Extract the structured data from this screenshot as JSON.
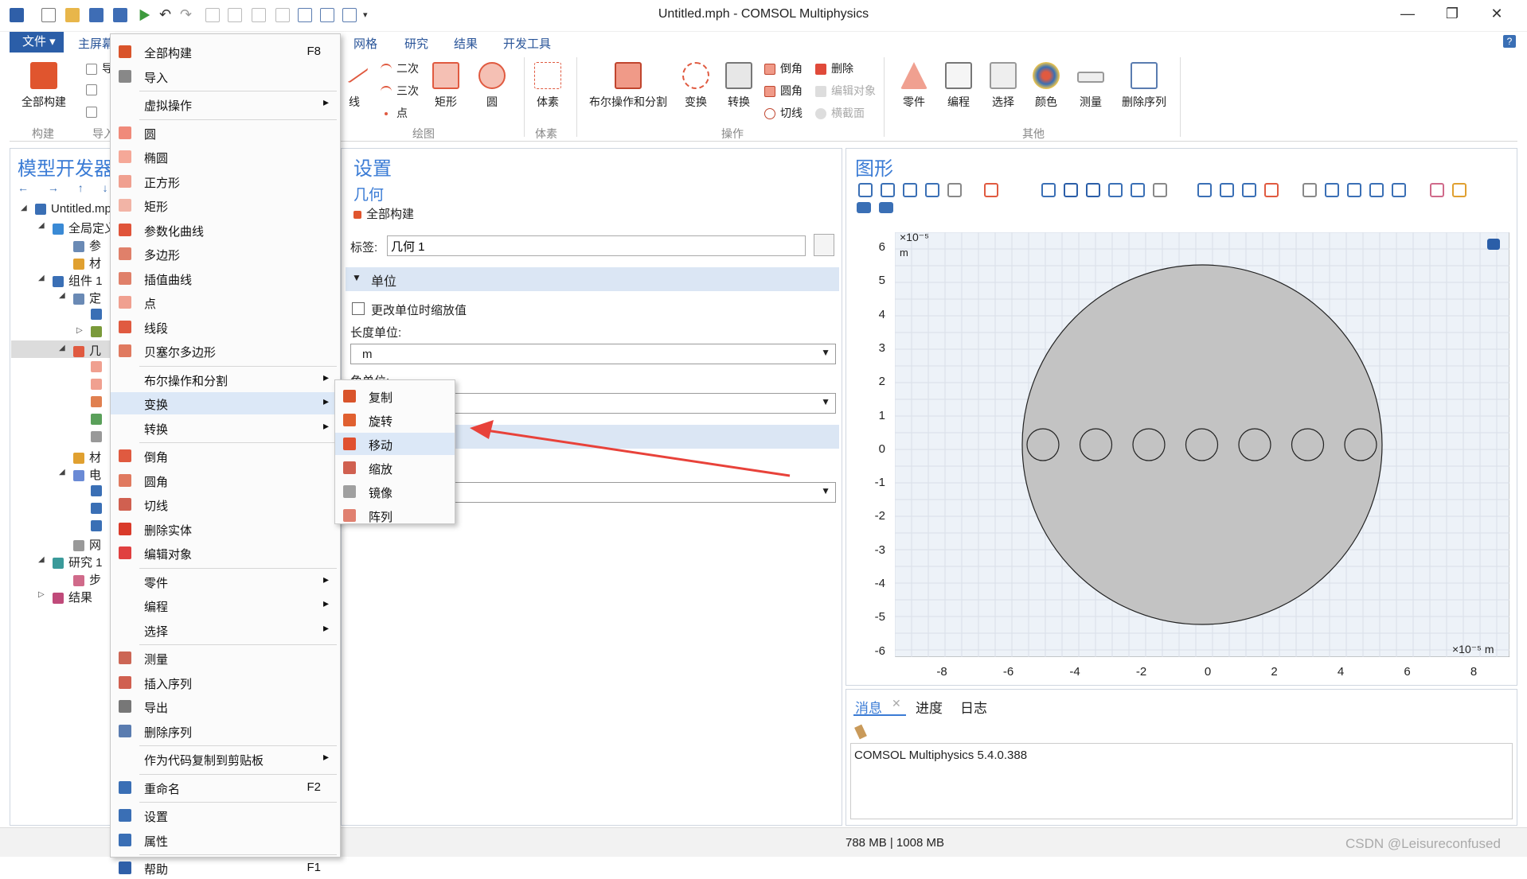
{
  "window": {
    "title": "Untitled.mph - COMSOL Multiphysics",
    "minimize": "—",
    "restore": "❐",
    "close": "✕"
  },
  "tabs": {
    "file": "文件 ▾",
    "home": "主屏幕",
    "mesh": "网格",
    "study": "研究",
    "results": "结果",
    "devtools": "开发工具",
    "help": "?"
  },
  "ribbon": {
    "build_all": "全部构建",
    "import_cut": "导",
    "g_build": "构建",
    "g_import": "导入",
    "line": "线",
    "quadratic": "二次",
    "cubic": "三次",
    "point": "点",
    "rectangle": "矩形",
    "circle": "圆",
    "g_draw": "绘图",
    "solid": "体素",
    "g_solid": "体素",
    "boolean": "布尔操作和分割",
    "transform": "变换",
    "convert": "转换",
    "chamfer": "倒角",
    "fillet": "圆角",
    "tangent": "切线",
    "delete": "删除",
    "edit_object": "编辑对象",
    "cross_section": "横截面",
    "g_ops": "操作",
    "parts": "零件",
    "programming": "编程",
    "selection": "选择",
    "color": "颜色",
    "measure": "测量",
    "delete_seq": "删除序列",
    "g_other": "其他"
  },
  "model_panel": {
    "title": "模型开发器",
    "tree": [
      {
        "label": "Untitled.mph"
      },
      {
        "label": "全局定义"
      },
      {
        "label": "参"
      },
      {
        "label": "材"
      },
      {
        "label": "组件 1"
      },
      {
        "label": "定"
      },
      {
        "label": ""
      },
      {
        "label": ""
      },
      {
        "label": "几"
      },
      {
        "label": ""
      },
      {
        "label": ""
      },
      {
        "label": ""
      },
      {
        "label": ""
      },
      {
        "label": ""
      },
      {
        "label": "材"
      },
      {
        "label": "电"
      },
      {
        "label": ""
      },
      {
        "label": ""
      },
      {
        "label": ""
      },
      {
        "label": "网"
      },
      {
        "label": "研究 1"
      },
      {
        "label": "步"
      },
      {
        "label": "结果"
      }
    ]
  },
  "context_menu": [
    {
      "label": "全部构建",
      "shortcut": "F8",
      "arrow": "",
      "icon": "#d9542b"
    },
    {
      "label": "导入",
      "shortcut": "",
      "arrow": "",
      "icon": "#888"
    },
    {
      "label": "虚拟操作",
      "shortcut": "",
      "arrow": "▸",
      "icon": ""
    },
    {
      "label": "圆",
      "shortcut": "",
      "arrow": "",
      "icon": "#f08a7a"
    },
    {
      "label": "椭圆",
      "shortcut": "",
      "arrow": "",
      "icon": "#f5a898"
    },
    {
      "label": "正方形",
      "shortcut": "",
      "arrow": "",
      "icon": "#f0a090"
    },
    {
      "label": "矩形",
      "shortcut": "",
      "arrow": "",
      "icon": "#f2b4a6"
    },
    {
      "label": "参数化曲线",
      "shortcut": "",
      "arrow": "",
      "icon": "#e0543a"
    },
    {
      "label": "多边形",
      "shortcut": "",
      "arrow": "",
      "icon": "#e0806a"
    },
    {
      "label": "插值曲线",
      "shortcut": "",
      "arrow": "",
      "icon": "#e0806a"
    },
    {
      "label": "点",
      "shortcut": "",
      "arrow": "",
      "icon": "#f0a090"
    },
    {
      "label": "线段",
      "shortcut": "",
      "arrow": "",
      "icon": "#e05a40"
    },
    {
      "label": "贝塞尔多边形",
      "shortcut": "",
      "arrow": "",
      "icon": "#e07a60"
    },
    {
      "label": "布尔操作和分割",
      "shortcut": "",
      "arrow": "▸",
      "icon": ""
    },
    {
      "label": "变换",
      "shortcut": "",
      "arrow": "▸",
      "icon": ""
    },
    {
      "label": "转换",
      "shortcut": "",
      "arrow": "▸",
      "icon": ""
    },
    {
      "label": "倒角",
      "shortcut": "",
      "arrow": "",
      "icon": "#e05a40"
    },
    {
      "label": "圆角",
      "shortcut": "",
      "arrow": "",
      "icon": "#e07a60"
    },
    {
      "label": "切线",
      "shortcut": "",
      "arrow": "",
      "icon": "#d06050"
    },
    {
      "label": "删除实体",
      "shortcut": "",
      "arrow": "",
      "icon": "#d93a2a"
    },
    {
      "label": "编辑对象",
      "shortcut": "",
      "arrow": "",
      "icon": "#e04040"
    },
    {
      "label": "零件",
      "shortcut": "",
      "arrow": "▸",
      "icon": ""
    },
    {
      "label": "编程",
      "shortcut": "",
      "arrow": "▸",
      "icon": ""
    },
    {
      "label": "选择",
      "shortcut": "",
      "arrow": "▸",
      "icon": ""
    },
    {
      "label": "测量",
      "shortcut": "",
      "arrow": "",
      "icon": "#cc6655"
    },
    {
      "label": "插入序列",
      "shortcut": "",
      "arrow": "",
      "icon": "#d06050"
    },
    {
      "label": "导出",
      "shortcut": "",
      "arrow": "",
      "icon": "#777"
    },
    {
      "label": "删除序列",
      "shortcut": "",
      "arrow": "",
      "icon": "#5a7cb0"
    },
    {
      "label": "作为代码复制到剪贴板",
      "shortcut": "",
      "arrow": "▸",
      "icon": ""
    },
    {
      "label": "重命名",
      "shortcut": "F2",
      "arrow": "",
      "icon": "#3a6fb5"
    },
    {
      "label": "设置",
      "shortcut": "",
      "arrow": "",
      "icon": "#3a6fb5"
    },
    {
      "label": "属性",
      "shortcut": "",
      "arrow": "",
      "icon": "#3a6fb5"
    },
    {
      "label": "帮助",
      "shortcut": "F1",
      "arrow": "",
      "icon": "#2f5fa8"
    }
  ],
  "submenu": [
    {
      "label": "复制",
      "icon": "#d9542b"
    },
    {
      "label": "旋转",
      "icon": "#e06030"
    },
    {
      "label": "移动",
      "icon": "#e05030"
    },
    {
      "label": "缩放",
      "icon": "#d06050"
    },
    {
      "label": "镜像",
      "icon": "#a0a0a0"
    },
    {
      "label": "阵列",
      "icon": "#e08070"
    }
  ],
  "settings": {
    "title": "设置",
    "subtitle": "几何",
    "build_all": "全部构建",
    "label_label": "标签:",
    "label_value": "几何 1",
    "section_units": "单位",
    "checkbox_label": "更改单位时缩放值",
    "length_unit_label": "长度单位:",
    "length_unit_value": "m",
    "angle_unit_label": "角单位:",
    "angle_unit_value": "",
    "combo3_value": ""
  },
  "graphics": {
    "title": "图形",
    "y_exp": "×10⁻⁵",
    "y_unit": "m",
    "x_exp": "×10⁻⁵  m",
    "y_ticks": [
      "6",
      "5",
      "4",
      "3",
      "2",
      "1",
      "0",
      "-1",
      "-2",
      "-3",
      "-4",
      "-5",
      "-6"
    ],
    "x_ticks": [
      "-8",
      "-6",
      "-4",
      "-2",
      "0",
      "2",
      "4",
      "6",
      "8"
    ]
  },
  "messages": {
    "tab_messages": "消息",
    "tab_progress": "进度",
    "tab_log": "日志",
    "content": "COMSOL Multiphysics 5.4.0.388"
  },
  "status": {
    "memory": "788 MB | 1008 MB",
    "watermark": "CSDN @Leisureconfused"
  },
  "colors": {
    "accent": "#2b5ea8",
    "title_blue": "#3a7bd5",
    "section_bg": "#dbe6f4",
    "geometry": "#c0c0c0",
    "arrow": "#e8423a"
  }
}
